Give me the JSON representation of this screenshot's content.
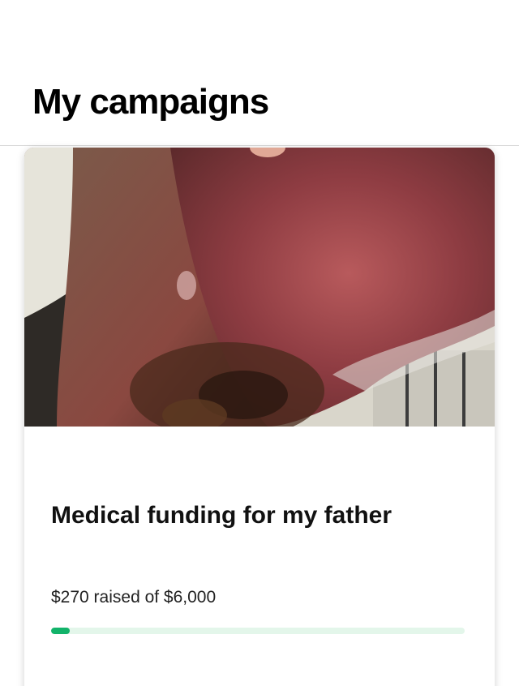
{
  "header": {
    "title": "My campaigns"
  },
  "campaign": {
    "image_alt": "campaign-photo",
    "title": "Medical funding for my father",
    "raised_text": "$270 raised of $6,000",
    "raised_amount": 270,
    "goal_amount": 6000,
    "progress_fraction": 0.045
  },
  "colors": {
    "progress_fill": "#12b36a",
    "progress_track": "#e3f6ea"
  }
}
